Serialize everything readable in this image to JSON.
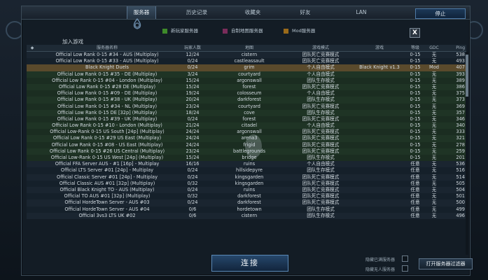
{
  "tabs": [
    {
      "label": "服务器",
      "active": true
    },
    {
      "label": "历史记录",
      "active": false
    },
    {
      "label": "收藏夹",
      "active": false
    },
    {
      "label": "好友",
      "active": false
    },
    {
      "label": "LAN",
      "active": false
    }
  ],
  "stop_label": "停止",
  "add_game_label": "加入游戏",
  "filters": [
    {
      "label": "新玩家服务器",
      "color": "#3e8a2a"
    },
    {
      "label": "自制地图服务器",
      "color": "#7a2c5a"
    },
    {
      "label": "Mod服务器",
      "color": "#9a6a1a"
    }
  ],
  "close_label": "X",
  "columns": {
    "name": "服务器名称",
    "players": "玩家人数",
    "map": "地图",
    "mode": "游戏模式",
    "mod": "游戏",
    "level": "等级",
    "gdc": "GDC",
    "ping": "Ping"
  },
  "rows": [
    {
      "name": "Official Low Rank 0-15 #34 - AUS (Multiplay)",
      "players": "12/24",
      "map": "cistern",
      "mode": "团队死亡竞赛模式",
      "mod": "",
      "level": "0-15",
      "gdc": "无",
      "ping": "538",
      "style": "odd"
    },
    {
      "name": "Official Low Rank 0-15 #33 - AUS (Multiplay)",
      "players": "0/24",
      "map": "castleassault",
      "mode": "团队死亡竞赛模式",
      "mod": "",
      "level": "0-15",
      "gdc": "无",
      "ping": "493",
      "style": "even"
    },
    {
      "name": "Black Knight Duels",
      "players": "0/24",
      "map": "grim",
      "mode": "个人自由模式",
      "mod": "Black Knight v1.3",
      "level": "0-15",
      "gdc": "Mod",
      "ping": "407",
      "style": "sel"
    },
    {
      "name": "Official Low Rank 0-15 #35 - DE (Multiplay)",
      "players": "3/24",
      "map": "courtyard",
      "mode": "个人自由模式",
      "mod": "",
      "level": "0-15",
      "gdc": "无",
      "ping": "393",
      "style": "green"
    },
    {
      "name": "Official Low Rank 0-15 #04 - London (Multiplay)",
      "players": "15/24",
      "map": "argonswall",
      "mode": "团队生存模式",
      "mod": "",
      "level": "0-15",
      "gdc": "无",
      "ping": "389",
      "style": "greenb"
    },
    {
      "name": "Official Low Rank 0-15 #28 DE (Multiplay)",
      "players": "15/24",
      "map": "forest",
      "mode": "团队死亡竞赛模式",
      "mod": "",
      "level": "0-15",
      "gdc": "无",
      "ping": "386",
      "style": "green"
    },
    {
      "name": "Official Low Rank 0-15 #09 - DE (Multiplay)",
      "players": "19/24",
      "map": "colosseum",
      "mode": "个人自由模式",
      "mod": "",
      "level": "0-15",
      "gdc": "无",
      "ping": "375",
      "style": "greenb"
    },
    {
      "name": "Official Low Rank 0-15 #38 - UK (Multiplay)",
      "players": "20/24",
      "map": "darkforest",
      "mode": "团队生存模式",
      "mod": "",
      "level": "0-15",
      "gdc": "无",
      "ping": "373",
      "style": "green"
    },
    {
      "name": "Official Low Rank 0-15 #34 - NL (Multiplay)",
      "players": "23/24",
      "map": "courtyard",
      "mode": "团队死亡竞赛模式",
      "mod": "",
      "level": "0-15",
      "gdc": "无",
      "ping": "369",
      "style": "greenb"
    },
    {
      "name": "Official Low Rank 0-15 DE [32p] (Multiplay)",
      "players": "18/24",
      "map": "cove",
      "mode": "团队生存模式",
      "mod": "",
      "level": "0-15",
      "gdc": "无",
      "ping": "357",
      "style": "green"
    },
    {
      "name": "Official Low Rank 0-15 #39 - UK (Multiplay)",
      "players": "0/24",
      "map": "forest",
      "mode": "团队死亡竞赛模式",
      "mod": "",
      "level": "0-15",
      "gdc": "无",
      "ping": "346",
      "style": "greenb"
    },
    {
      "name": "Official Low Rank 0-15 #10 - London (Multiplay)",
      "players": "21/24",
      "map": "citadel",
      "mode": "个人自由模式",
      "mod": "",
      "level": "0-15",
      "gdc": "无",
      "ping": "340",
      "style": "green"
    },
    {
      "name": "Official Low-Rank 0-15 US South [24p] (Multiplay)",
      "players": "24/24",
      "map": "argonswall",
      "mode": "团队死亡竞赛模式",
      "mod": "",
      "level": "0-15",
      "gdc": "无",
      "ping": "333",
      "style": "greenb"
    },
    {
      "name": "Official Low Rank 0-15 #29 US East (Multiplay)",
      "players": "24/24",
      "map": "arena3",
      "mode": "团队死亡竞赛模式",
      "mod": "",
      "level": "0-15",
      "gdc": "无",
      "ping": "321",
      "style": "green"
    },
    {
      "name": "Official Low Rank 0-15 #08 - US East (Multiplay)",
      "players": "24/24",
      "map": "frigid",
      "mode": "团队死亡竞赛模式",
      "mod": "",
      "level": "0-15",
      "gdc": "无",
      "ping": "278",
      "style": "greenb"
    },
    {
      "name": "Official Low Rank 0-15 #26 US Central (Multiplay)",
      "players": "23/24",
      "map": "battlegrounds",
      "mode": "团队死亡竞赛模式",
      "mod": "",
      "level": "0-15",
      "gdc": "无",
      "ping": "259",
      "style": "green"
    },
    {
      "name": "Official Low-Rank 0-15 US West [24p] (Multiplay)",
      "players": "15/24",
      "map": "bridge",
      "mode": "团队生存模式",
      "mod": "",
      "level": "0-15",
      "gdc": "无",
      "ping": "201",
      "style": "greenb"
    },
    {
      "name": "Official FFA Server AUS - #1 [16p] - Multiplay",
      "players": "16/16",
      "map": "ruins",
      "mode": "个人自由模式",
      "mod": "",
      "level": "任意",
      "gdc": "无",
      "ping": "536",
      "style": "odd"
    },
    {
      "name": "Official LTS Server #01 [24p] - Multiplay",
      "players": "0/24",
      "map": "hillsidepyre",
      "mode": "团队生存模式",
      "mod": "",
      "level": "任意",
      "gdc": "无",
      "ping": "516",
      "style": "even"
    },
    {
      "name": "Official Classic Server #01 [24p] - Multiplay",
      "players": "0/24",
      "map": "kingsgarden",
      "mode": "团队死亡竞赛模式",
      "mod": "",
      "level": "任意",
      "gdc": "无",
      "ping": "514",
      "style": "odd"
    },
    {
      "name": "Official Classic AUS #01 [32p] (Multiplay)",
      "players": "0/32",
      "map": "kingsgarden",
      "mode": "团队死亡竞赛模式",
      "mod": "",
      "level": "任意",
      "gdc": "无",
      "ping": "505",
      "style": "even"
    },
    {
      "name": "Official Black Knight TO - AUS (Multiplay)",
      "players": "0/24",
      "map": "ruins",
      "mode": "团队死亡竞赛模式",
      "mod": "",
      "level": "任意",
      "gdc": "无",
      "ping": "504",
      "style": "odd"
    },
    {
      "name": "Official TO AUS #01 [32p] (Multiplay)",
      "players": "0/32",
      "map": "darkforest",
      "mode": "团队死亡竞赛模式",
      "mod": "",
      "level": "任意",
      "gdc": "无",
      "ping": "501",
      "style": "even"
    },
    {
      "name": "Official HordeTown Server - AUS #03",
      "players": "0/24",
      "map": "darkforest",
      "mode": "团队死亡竞赛模式",
      "mod": "",
      "level": "任意",
      "gdc": "无",
      "ping": "500",
      "style": "odd"
    },
    {
      "name": "Official HordeTown Server - AUS #04",
      "players": "0/6",
      "map": "hordetown",
      "mode": "团队生存模式",
      "mod": "",
      "level": "任意",
      "gdc": "无",
      "ping": "499",
      "style": "even"
    },
    {
      "name": "Official 3vs3 LTS UK #02",
      "players": "0/6",
      "map": "cistern",
      "mode": "团队生存模式",
      "mod": "",
      "level": "任意",
      "gdc": "无",
      "ping": "496",
      "style": "odd"
    }
  ],
  "connect_label": "连接",
  "hide_full_label": "隐藏已满服务器",
  "hide_empty_label": "隐藏无人服务器",
  "open_filter_label": "打开服务器过滤器",
  "colors": {
    "accent": "#4e7aa6",
    "selected_row": "#5a4a2c",
    "new_player_row": "#1f3425"
  }
}
